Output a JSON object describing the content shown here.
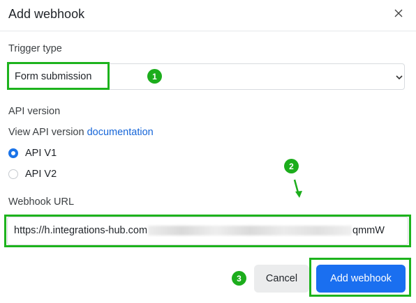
{
  "dialog": {
    "title": "Add webhook",
    "close_icon": "close-icon"
  },
  "trigger": {
    "label": "Trigger type",
    "selected": "Form submission",
    "dropdown_icon": "chevron-down-icon"
  },
  "api": {
    "label": "API version",
    "hint_prefix": "View API version ",
    "hint_link": "documentation",
    "options": [
      {
        "label": "API V1",
        "selected": true
      },
      {
        "label": "API V2",
        "selected": false
      }
    ]
  },
  "webhook": {
    "label": "Webhook URL",
    "url_visible_start": "https://h.integrations-hub.com",
    "url_visible_end": "qmmW"
  },
  "buttons": {
    "cancel": "Cancel",
    "add": "Add webhook"
  },
  "annotations": {
    "badge1": "1",
    "badge2": "2",
    "badge3": "3",
    "highlight_color": "#1db31d"
  }
}
